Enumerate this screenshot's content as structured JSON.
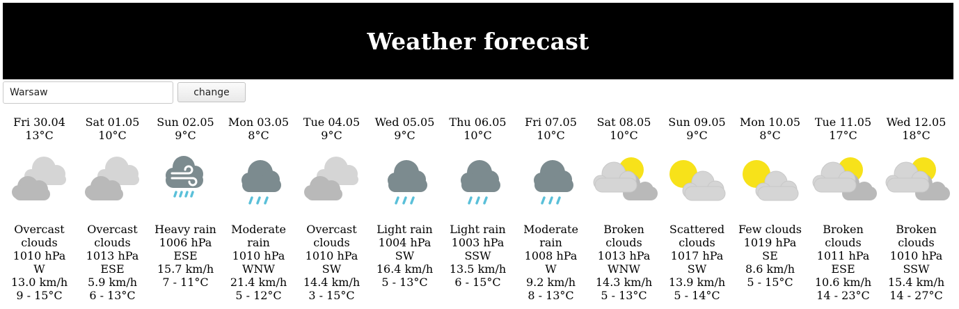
{
  "header": {
    "title": "Weather forecast"
  },
  "search": {
    "value": "Warsaw",
    "button_label": "change"
  },
  "forecast": [
    {
      "date": "Fri 30.04",
      "temp": "13°C",
      "icon": "overcast-clouds-icon",
      "desc": "Overcast clouds",
      "pressure": "1010 hPa",
      "wind_dir": "W",
      "wind_speed": "13.0 km/h",
      "range": "9 - 15°C"
    },
    {
      "date": "Sat 01.05",
      "temp": "10°C",
      "icon": "overcast-clouds-icon",
      "desc": "Overcast clouds",
      "pressure": "1013 hPa",
      "wind_dir": "ESE",
      "wind_speed": "5.9 km/h",
      "range": "6 - 13°C"
    },
    {
      "date": "Sun 02.05",
      "temp": "9°C",
      "icon": "heavy-rain-wind-icon",
      "desc": "Heavy rain",
      "pressure": "1006 hPa",
      "wind_dir": "ESE",
      "wind_speed": "15.7 km/h",
      "range": "7 - 11°C"
    },
    {
      "date": "Mon 03.05",
      "temp": "8°C",
      "icon": "rain-cloud-icon",
      "desc": "Moderate rain",
      "pressure": "1010 hPa",
      "wind_dir": "WNW",
      "wind_speed": "21.4 km/h",
      "range": "5 - 12°C"
    },
    {
      "date": "Tue 04.05",
      "temp": "9°C",
      "icon": "overcast-clouds-icon",
      "desc": "Overcast clouds",
      "pressure": "1010 hPa",
      "wind_dir": "SW",
      "wind_speed": "14.4 km/h",
      "range": "3 - 15°C"
    },
    {
      "date": "Wed 05.05",
      "temp": "9°C",
      "icon": "rain-cloud-icon",
      "desc": "Light rain",
      "pressure": "1004 hPa",
      "wind_dir": "SW",
      "wind_speed": "16.4 km/h",
      "range": "5 - 13°C"
    },
    {
      "date": "Thu 06.05",
      "temp": "10°C",
      "icon": "rain-cloud-icon",
      "desc": "Light rain",
      "pressure": "1003 hPa",
      "wind_dir": "SSW",
      "wind_speed": "13.5 km/h",
      "range": "6 - 15°C"
    },
    {
      "date": "Fri 07.05",
      "temp": "10°C",
      "icon": "rain-cloud-icon",
      "desc": "Moderate rain",
      "pressure": "1008 hPa",
      "wind_dir": "W",
      "wind_speed": "9.2 km/h",
      "range": "8 - 13°C"
    },
    {
      "date": "Sat 08.05",
      "temp": "10°C",
      "icon": "broken-clouds-icon",
      "desc": "Broken clouds",
      "pressure": "1013 hPa",
      "wind_dir": "WNW",
      "wind_speed": "14.3 km/h",
      "range": "5 - 13°C"
    },
    {
      "date": "Sun 09.05",
      "temp": "9°C",
      "icon": "sun-behind-cloud-icon",
      "desc": "Scattered clouds",
      "pressure": "1017 hPa",
      "wind_dir": "SW",
      "wind_speed": "13.9 km/h",
      "range": "5 - 14°C"
    },
    {
      "date": "Mon 10.05",
      "temp": "8°C",
      "icon": "sun-behind-cloud-icon",
      "desc": "Few clouds",
      "pressure": "1019 hPa",
      "wind_dir": "SE",
      "wind_speed": "8.6 km/h",
      "range": "5 - 15°C"
    },
    {
      "date": "Tue 11.05",
      "temp": "17°C",
      "icon": "broken-clouds-icon",
      "desc": "Broken clouds",
      "pressure": "1011 hPa",
      "wind_dir": "ESE",
      "wind_speed": "10.6 km/h",
      "range": "14 - 23°C"
    },
    {
      "date": "Wed 12.05",
      "temp": "18°C",
      "icon": "broken-clouds-icon",
      "desc": "Broken clouds",
      "pressure": "1010 hPa",
      "wind_dir": "SSW",
      "wind_speed": "15.4 km/h",
      "range": "14 - 27°C"
    }
  ],
  "colors": {
    "header_bg": "#000000",
    "cloud_light": "#d5d5d5",
    "cloud_mid": "#b9b9b9",
    "rain_cloud": "#7c8b8f",
    "rain_drop": "#5ac0d9",
    "sun": "#f7e21a"
  }
}
